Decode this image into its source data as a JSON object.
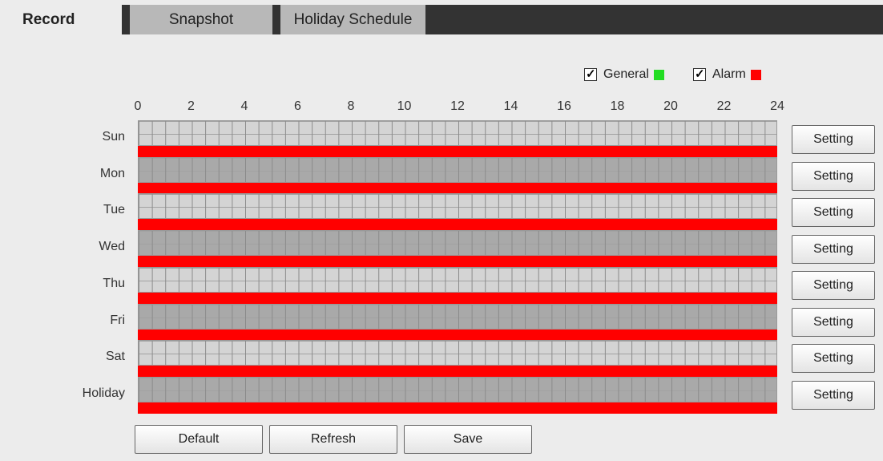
{
  "tabs": {
    "record": "Record",
    "snapshot": "Snapshot",
    "holiday_schedule": "Holiday Schedule"
  },
  "legend": {
    "general_label": "General",
    "general_checked": true,
    "general_color": "#22dd22",
    "alarm_label": "Alarm",
    "alarm_checked": true,
    "alarm_color": "#ff0000"
  },
  "axis": {
    "ticks": [
      "0",
      "2",
      "4",
      "6",
      "8",
      "10",
      "12",
      "14",
      "16",
      "18",
      "20",
      "22",
      "24"
    ]
  },
  "schedule": {
    "days": [
      {
        "label": "Sun",
        "setting": "Setting"
      },
      {
        "label": "Mon",
        "setting": "Setting"
      },
      {
        "label": "Tue",
        "setting": "Setting"
      },
      {
        "label": "Wed",
        "setting": "Setting"
      },
      {
        "label": "Thu",
        "setting": "Setting"
      },
      {
        "label": "Fri",
        "setting": "Setting"
      },
      {
        "label": "Sat",
        "setting": "Setting"
      },
      {
        "label": "Holiday",
        "setting": "Setting"
      }
    ],
    "alarm_period": [
      "00:00",
      "24:00"
    ]
  },
  "buttons": {
    "default": "Default",
    "refresh": "Refresh",
    "save": "Save"
  }
}
